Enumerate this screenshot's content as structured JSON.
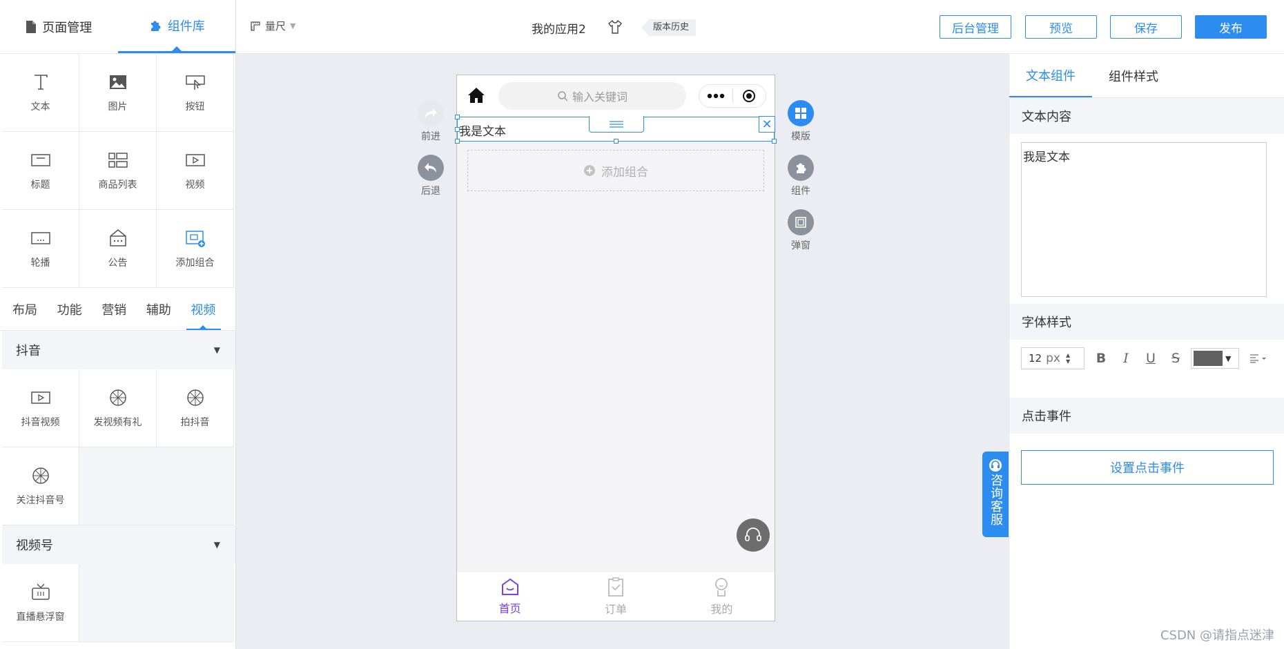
{
  "left_panel": {
    "tabs": [
      {
        "label": "页面管理",
        "icon": "document-icon",
        "active": false
      },
      {
        "label": "组件库",
        "icon": "puzzle-icon",
        "active": true
      }
    ],
    "components": [
      {
        "label": "文本",
        "icon": "text-icon"
      },
      {
        "label": "图片",
        "icon": "image-icon"
      },
      {
        "label": "按钮",
        "icon": "button-icon"
      },
      {
        "label": "标题",
        "icon": "title-icon"
      },
      {
        "label": "商品列表",
        "icon": "product-list-icon"
      },
      {
        "label": "视频",
        "icon": "video-icon"
      },
      {
        "label": "轮播",
        "icon": "carousel-icon"
      },
      {
        "label": "公告",
        "icon": "notice-icon"
      },
      {
        "label": "添加组合",
        "icon": "add-group-icon"
      }
    ],
    "categories": [
      "布局",
      "功能",
      "营销",
      "辅助",
      "视频"
    ],
    "active_category": "视频",
    "sections": [
      {
        "title": "抖音",
        "items": [
          "抖音视频",
          "发视频有礼",
          "拍抖音",
          "关注抖音号"
        ]
      },
      {
        "title": "视频号",
        "items": [
          "直播悬浮窗"
        ]
      }
    ]
  },
  "topbar": {
    "ruler_label": "量尺",
    "app_name": "我的应用2",
    "history_label": "版本历史",
    "buttons": {
      "admin": "后台管理",
      "preview": "预览",
      "save": "保存",
      "publish": "发布"
    }
  },
  "canvas": {
    "side_left": {
      "forward": "前进",
      "back": "后退"
    },
    "side_right": {
      "template": "模版",
      "component": "组件",
      "popup": "弹窗"
    },
    "phone": {
      "search_placeholder": "输入关键词",
      "text_component": "我是文本",
      "add_combo": "添加组合",
      "tabbar": [
        {
          "label": "首页",
          "icon": "home-tab-icon",
          "active": true
        },
        {
          "label": "订单",
          "icon": "clipboard-icon",
          "active": false
        },
        {
          "label": "我的",
          "icon": "person-icon",
          "active": false
        }
      ]
    },
    "consult_label": "咨询客服"
  },
  "right_panel": {
    "tabs": [
      "文本组件",
      "组件样式"
    ],
    "text_content_title": "文本内容",
    "text_value": "我是文本",
    "font_style_title": "字体样式",
    "font_size": "12",
    "font_unit": "px",
    "font_color": "#606060",
    "click_event_title": "点击事件",
    "set_click_label": "设置点击事件"
  },
  "watermark": "CSDN @请指点迷津",
  "colors": {
    "accent": "#2d8cf0",
    "tab_active": "#7b3ff2"
  }
}
